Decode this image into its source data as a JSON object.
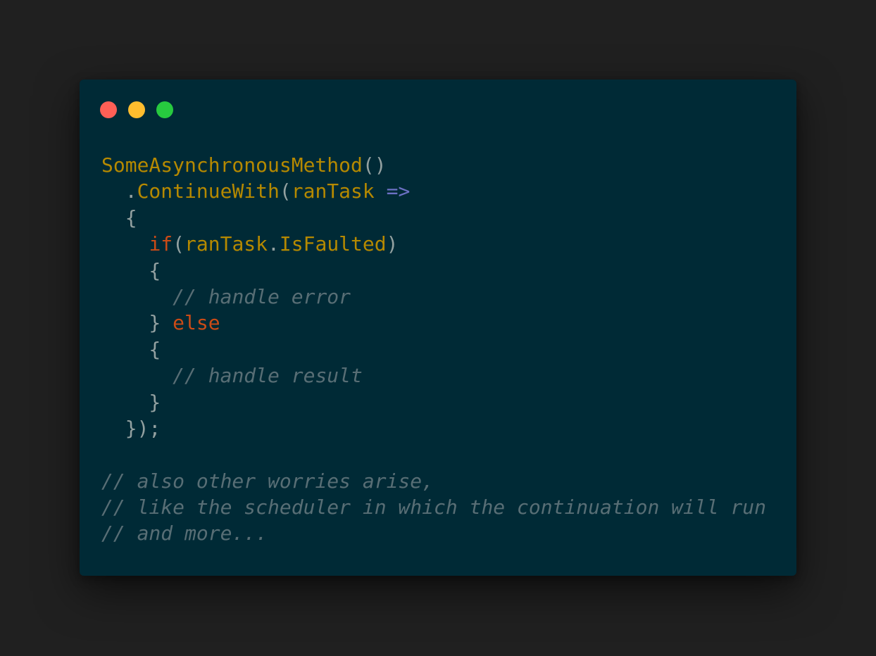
{
  "colors": {
    "page_background": "#202020",
    "window_background": "#002a36",
    "close_dot": "#ff5f56",
    "minimize_dot": "#ffbd2e",
    "maximize_dot": "#27c93f",
    "function": "#b58900",
    "identifier": "#b58900",
    "keyword": "#cb4b16",
    "operator": "#6c71c4",
    "punctuation": "#93a1a1",
    "comment": "#586e75"
  },
  "window_controls": [
    {
      "name": "close-dot-icon",
      "color": "#ff5f56"
    },
    {
      "name": "minimize-dot-icon",
      "color": "#ffbd2e"
    },
    {
      "name": "maximize-dot-icon",
      "color": "#27c93f"
    }
  ],
  "code": {
    "lines": [
      [
        {
          "t": "fn",
          "v": "SomeAsynchronousMethod"
        },
        {
          "t": "punc",
          "v": "()"
        }
      ],
      [
        {
          "t": "punc",
          "v": "  ."
        },
        {
          "t": "fn",
          "v": "ContinueWith"
        },
        {
          "t": "punc",
          "v": "("
        },
        {
          "t": "id",
          "v": "ranTask"
        },
        {
          "t": "punc",
          "v": " "
        },
        {
          "t": "op",
          "v": "=>"
        }
      ],
      [
        {
          "t": "punc",
          "v": "  {"
        }
      ],
      [
        {
          "t": "punc",
          "v": "    "
        },
        {
          "t": "kw",
          "v": "if"
        },
        {
          "t": "punc",
          "v": "("
        },
        {
          "t": "id",
          "v": "ranTask"
        },
        {
          "t": "punc",
          "v": "."
        },
        {
          "t": "id",
          "v": "IsFaulted"
        },
        {
          "t": "punc",
          "v": ")"
        }
      ],
      [
        {
          "t": "punc",
          "v": "    {"
        }
      ],
      [
        {
          "t": "punc",
          "v": "      "
        },
        {
          "t": "cmt",
          "v": "// handle error"
        }
      ],
      [
        {
          "t": "punc",
          "v": "    } "
        },
        {
          "t": "kw",
          "v": "else"
        }
      ],
      [
        {
          "t": "punc",
          "v": "    {"
        }
      ],
      [
        {
          "t": "punc",
          "v": "      "
        },
        {
          "t": "cmt",
          "v": "// handle result"
        }
      ],
      [
        {
          "t": "punc",
          "v": "    }"
        }
      ],
      [
        {
          "t": "punc",
          "v": "  });"
        }
      ],
      [],
      [
        {
          "t": "cmt",
          "v": "// also other worries arise,"
        }
      ],
      [
        {
          "t": "cmt",
          "v": "// like the scheduler in which the continuation will run"
        }
      ],
      [
        {
          "t": "cmt",
          "v": "// and more..."
        }
      ]
    ]
  }
}
